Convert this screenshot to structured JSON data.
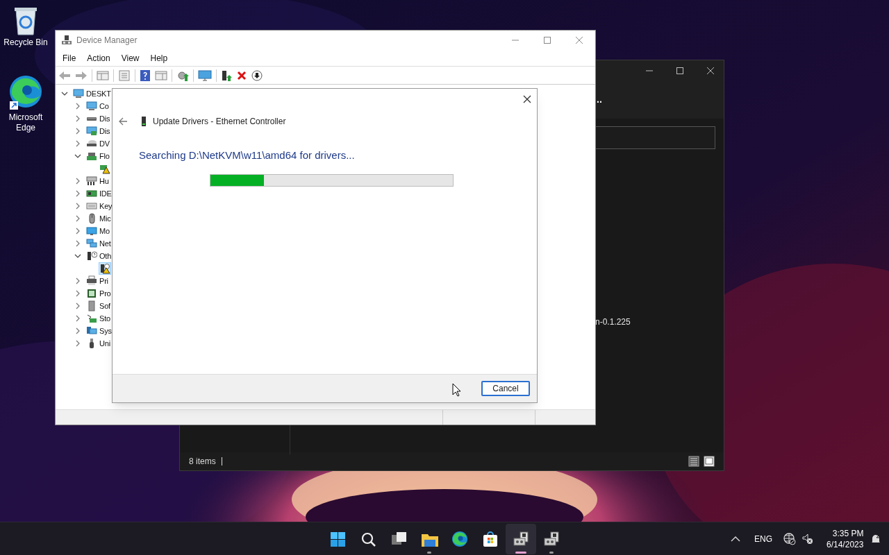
{
  "desktop_icons": [
    {
      "kind": "recycle_bin",
      "label": "Recycle Bin"
    },
    {
      "kind": "edge",
      "label": "Microsoft Edge"
    }
  ],
  "explorer_window": {
    "title_fragment": "..",
    "visible_text": "n-0.1.225",
    "status": "8 items"
  },
  "device_manager": {
    "title": "Device Manager",
    "menu": [
      "File",
      "Action",
      "View",
      "Help"
    ],
    "tree": [
      {
        "kind": "computer",
        "label": "DESKT",
        "expanded": true,
        "selected": false,
        "children": [
          {
            "kind": "computer",
            "label": "Co",
            "expanded": false,
            "selected": false
          },
          {
            "kind": "disk",
            "label": "Dis",
            "expanded": false,
            "selected": false
          },
          {
            "kind": "display",
            "label": "Dis",
            "expanded": false,
            "selected": false
          },
          {
            "kind": "dvd",
            "label": "DV",
            "expanded": false,
            "selected": false
          },
          {
            "kind": "floppy",
            "label": "Flo",
            "expanded": true,
            "selected": false,
            "children": [
              {
                "kind": "warning_device",
                "selected": false
              }
            ]
          },
          {
            "kind": "hid",
            "label": "Hu",
            "expanded": false,
            "selected": false
          },
          {
            "kind": "ide",
            "label": "IDE",
            "expanded": false,
            "selected": false
          },
          {
            "kind": "keyboard",
            "label": "Key",
            "expanded": false,
            "selected": false
          },
          {
            "kind": "mouse",
            "label": "Mic",
            "expanded": false,
            "selected": false
          },
          {
            "kind": "monitor",
            "label": "Mo",
            "expanded": false,
            "selected": false
          },
          {
            "kind": "network",
            "label": "Net",
            "expanded": false,
            "selected": false
          },
          {
            "kind": "other",
            "label": "Oth",
            "expanded": true,
            "selected": false,
            "children": [
              {
                "kind": "unknown_warning",
                "selected": true
              }
            ]
          },
          {
            "kind": "printer",
            "label": "Pri",
            "expanded": false,
            "selected": false
          },
          {
            "kind": "processor",
            "label": "Pro",
            "expanded": false,
            "selected": false
          },
          {
            "kind": "software",
            "label": "Sof",
            "expanded": false,
            "selected": false
          },
          {
            "kind": "storage",
            "label": "Sto",
            "expanded": false,
            "selected": false
          },
          {
            "kind": "system",
            "label": "Sys",
            "expanded": false,
            "selected": false
          },
          {
            "kind": "usb",
            "label": "Uni",
            "expanded": false,
            "selected": false
          }
        ]
      }
    ]
  },
  "dialog": {
    "title": "Update Drivers - Ethernet Controller",
    "message": "Searching D:\\NetKVM\\w11\\amd64 for drivers...",
    "level": 0.22,
    "button": "Cancel"
  },
  "taskbar": {
    "apps": [
      {
        "kind": "start",
        "running": false,
        "selected": false
      },
      {
        "kind": "search",
        "running": false,
        "selected": false
      },
      {
        "kind": "taskview",
        "running": false,
        "selected": false
      },
      {
        "kind": "explorer",
        "running": true,
        "selected": false
      },
      {
        "kind": "edge",
        "running": false,
        "selected": false
      },
      {
        "kind": "store",
        "running": false,
        "selected": false
      },
      {
        "kind": "installer",
        "running": true,
        "selected": true
      },
      {
        "kind": "installer",
        "running": true,
        "selected": false
      }
    ],
    "language": "ENG",
    "time": "3:35 PM",
    "date": "6/14/2023"
  }
}
